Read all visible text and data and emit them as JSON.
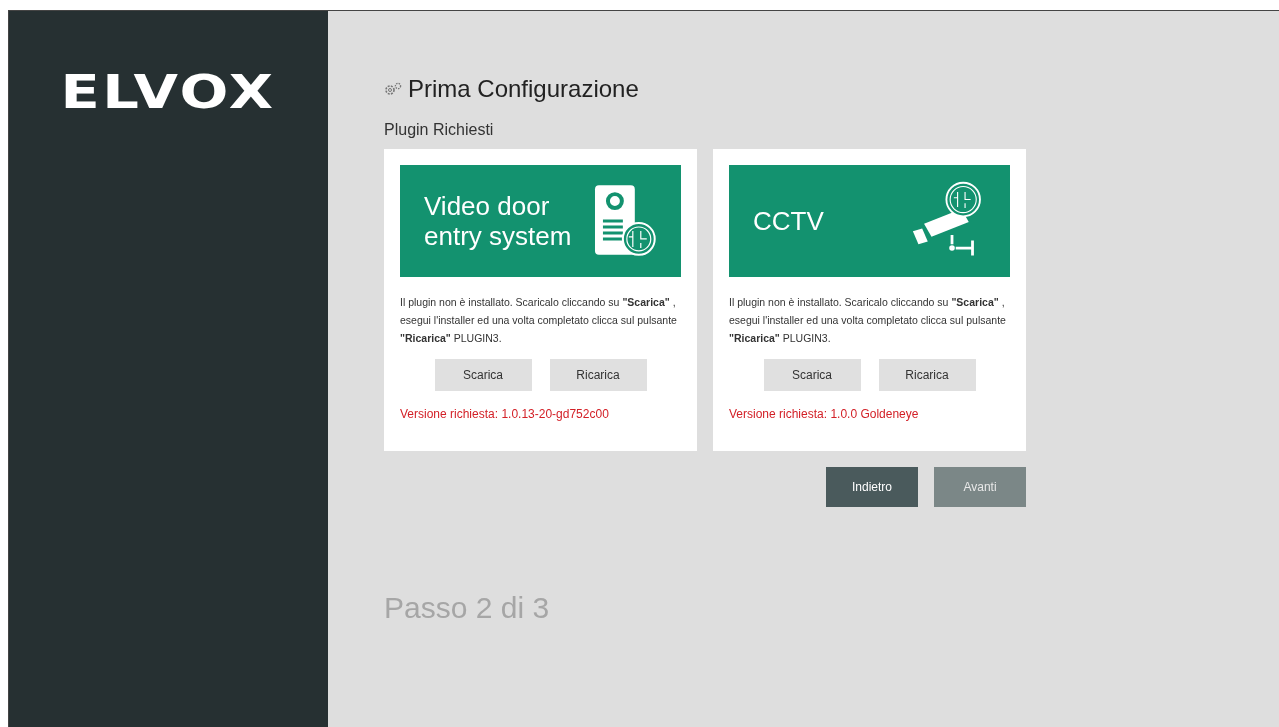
{
  "sidebar": {
    "logo": "ELVOX"
  },
  "header": {
    "title": "Prima Configurazione"
  },
  "section_title": "Plugin Richiesti",
  "plugins": [
    {
      "kind": "door-station",
      "banner": "Video door entry system",
      "message": "Il plugin non è installato. Scaricalo cliccando su **\"Scarica\"** , esegui l'installer ed una volta completato clicca sul pulsante **\"Ricarica\"** PLUGIN3.",
      "buttons": [
        "Scarica",
        "Ricarica"
      ],
      "version": "Versione richiesta: 1.0.13-20-gd752c00"
    },
    {
      "kind": "camera",
      "banner": "CCTV",
      "message": "Il plugin non è installato. Scaricalo cliccando su **\"Scarica\"** , esegui l'installer ed una volta completato clicca sul pulsante **\"Ricarica\"** PLUGIN3.",
      "buttons": [
        "Scarica",
        "Ricarica"
      ],
      "version": "Versione richiesta: 1.0.0 Goldeneye"
    }
  ],
  "nav": [
    {
      "label": "Indietro",
      "disabled": false
    },
    {
      "label": "Avanti",
      "disabled": true
    }
  ],
  "step": "Passo 2 di 3"
}
